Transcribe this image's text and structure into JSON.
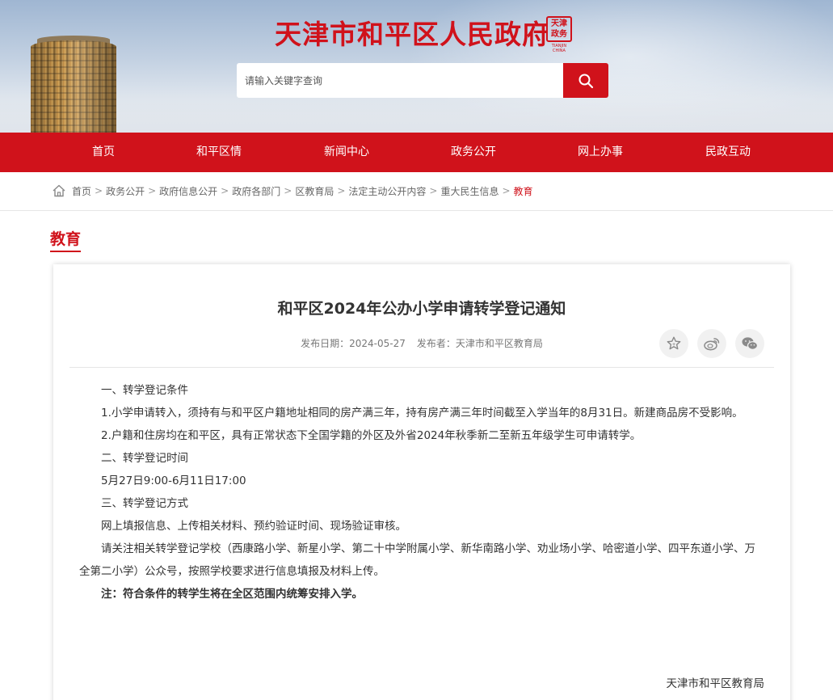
{
  "header": {
    "site_title": "天津市和平区人民政府",
    "seal_text": "天津 政务",
    "seal_sub": "TIANJIN CHINA",
    "search_placeholder": "请输入关键字查询"
  },
  "nav": {
    "items": [
      "首页",
      "和平区情",
      "新闻中心",
      "政务公开",
      "网上办事",
      "民政互动"
    ]
  },
  "breadcrumb": {
    "items": [
      "首页",
      "政务公开",
      "政府信息公开",
      "政府各部门",
      "区教育局",
      "法定主动公开内容",
      "重大民生信息"
    ],
    "current": "教育"
  },
  "section": {
    "title": "教育"
  },
  "article": {
    "title": "和平区2024年公办小学申请转学登记通知",
    "date_label": "发布日期：",
    "date": "2024-05-27",
    "publisher_label": "发布者：",
    "publisher": "天津市和平区教育局",
    "paragraphs": [
      "一、转学登记条件",
      "1.小学申请转入，须持有与和平区户籍地址相同的房产满三年，持有房产满三年时间截至入学当年的8月31日。新建商品房不受影响。",
      "2.户籍和住房均在和平区，具有正常状态下全国学籍的外区及外省2024年秋季新二至新五年级学生可申请转学。",
      "二、转学登记时间",
      "5月27日9:00-6月11日17:00",
      "三、转学登记方式",
      "网上填报信息、上传相关材料、预约验证时间、现场验证审核。",
      "请关注相关转学登记学校（西康路小学、新星小学、第二十中学附属小学、新华南路小学、劝业场小学、哈密道小学、四平东道小学、万全第二小学）公众号，按照学校要求进行信息填报及材料上传。",
      "注：符合条件的转学生将在全区范围内统筹安排入学。"
    ],
    "signature": "天津市和平区教育局"
  },
  "colors": {
    "brand_red": "#d0121b",
    "share_bg": "#f1f1f1"
  },
  "icons": {
    "search": "search-icon",
    "home": "home-icon",
    "favorite": "star-icon",
    "weibo": "weibo-icon",
    "wechat": "wechat-icon"
  }
}
